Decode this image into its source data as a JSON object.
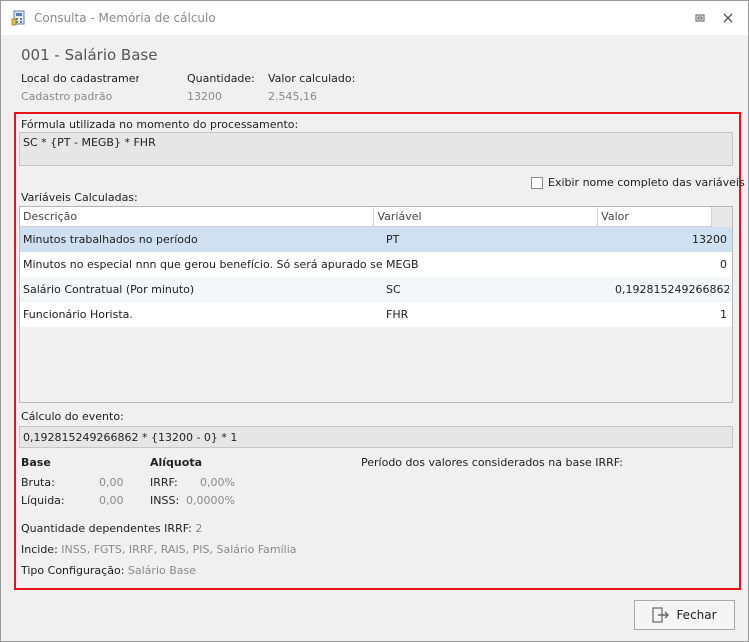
{
  "window": {
    "title": "Consulta - Memória de cálculo",
    "icon": "calculator-doc-icon",
    "controls": [
      "restore-icon",
      "close-icon"
    ]
  },
  "event": {
    "title": "001 - Salário Base",
    "local_label": "Local do cadastramento:",
    "local_value": "Cadastro padrão",
    "quantidade_label": "Quantidade:",
    "quantidade_value": "13200",
    "valor_label": "Valor calculado:",
    "valor_value": "2.545,16"
  },
  "formula": {
    "label": "Fórmula utilizada no momento do processamento:",
    "value": "SC * {PT - MEGB} * FHR"
  },
  "variables": {
    "label": "Variáveis Calculadas:",
    "show_full_name_label": "Exibir nome completo das variáveis",
    "show_full_name_checked": false,
    "columns": [
      "Descrição",
      "Variável",
      "Valor"
    ],
    "rows": [
      {
        "descricao": "Minutos trabalhados no período",
        "variavel": "PT",
        "valor": "13200",
        "selected": true
      },
      {
        "descricao": "Minutos no especial nnn que gerou benefício. Só será apurado se a opção",
        "variavel": "MEGB",
        "valor": "0",
        "selected": false
      },
      {
        "descricao": "Salário Contratual (Por minuto)",
        "variavel": "SC",
        "valor": "0,192815249266862",
        "selected": false
      },
      {
        "descricao": "Funcionário Horista.",
        "variavel": "FHR",
        "valor": "1",
        "selected": false
      }
    ]
  },
  "calculo": {
    "label": "Cálculo do evento:",
    "value": "0,192815249266862 * {13200 - 0} * 1"
  },
  "base": {
    "header": "Base",
    "bruta_label": "Bruta:",
    "bruta_value": "0,00",
    "liquida_label": "Líquida:",
    "liquida_value": "0,00"
  },
  "aliquota": {
    "header": "Alíquota",
    "irrf_label": "IRRF:",
    "irrf_value": "0,00%",
    "inss_label": "INSS:",
    "inss_value": "0,0000%"
  },
  "periodo_label": "Período dos valores considerados na base IRRF:",
  "dependentes": {
    "label": "Quantidade dependentes IRRF:",
    "value": "2"
  },
  "incide": {
    "label": "Incide:",
    "value": "INSS, FGTS, IRRF, RAIS, PIS, Salário Família"
  },
  "tipo_config": {
    "label": "Tipo Configuração:",
    "value": "Salário Base"
  },
  "footer": {
    "close_label": "Fechar"
  },
  "colors": {
    "highlight_border": "#e8141c",
    "selected_row": "#cfe0f1"
  }
}
